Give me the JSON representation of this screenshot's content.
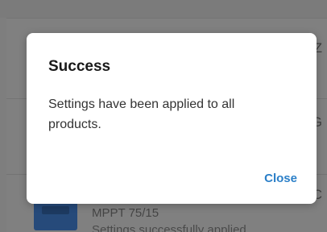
{
  "dialog": {
    "title": "Success",
    "message": "Settings have been applied to all products.",
    "close_label": "Close"
  },
  "background": {
    "edge_chars": [
      "Z",
      "G",
      "C"
    ],
    "device_name": "MPPT 75/15",
    "device_status": "Settings successfully applied"
  },
  "colors": {
    "accent": "#2b7fc8",
    "scrim": "#7e7e7e"
  }
}
